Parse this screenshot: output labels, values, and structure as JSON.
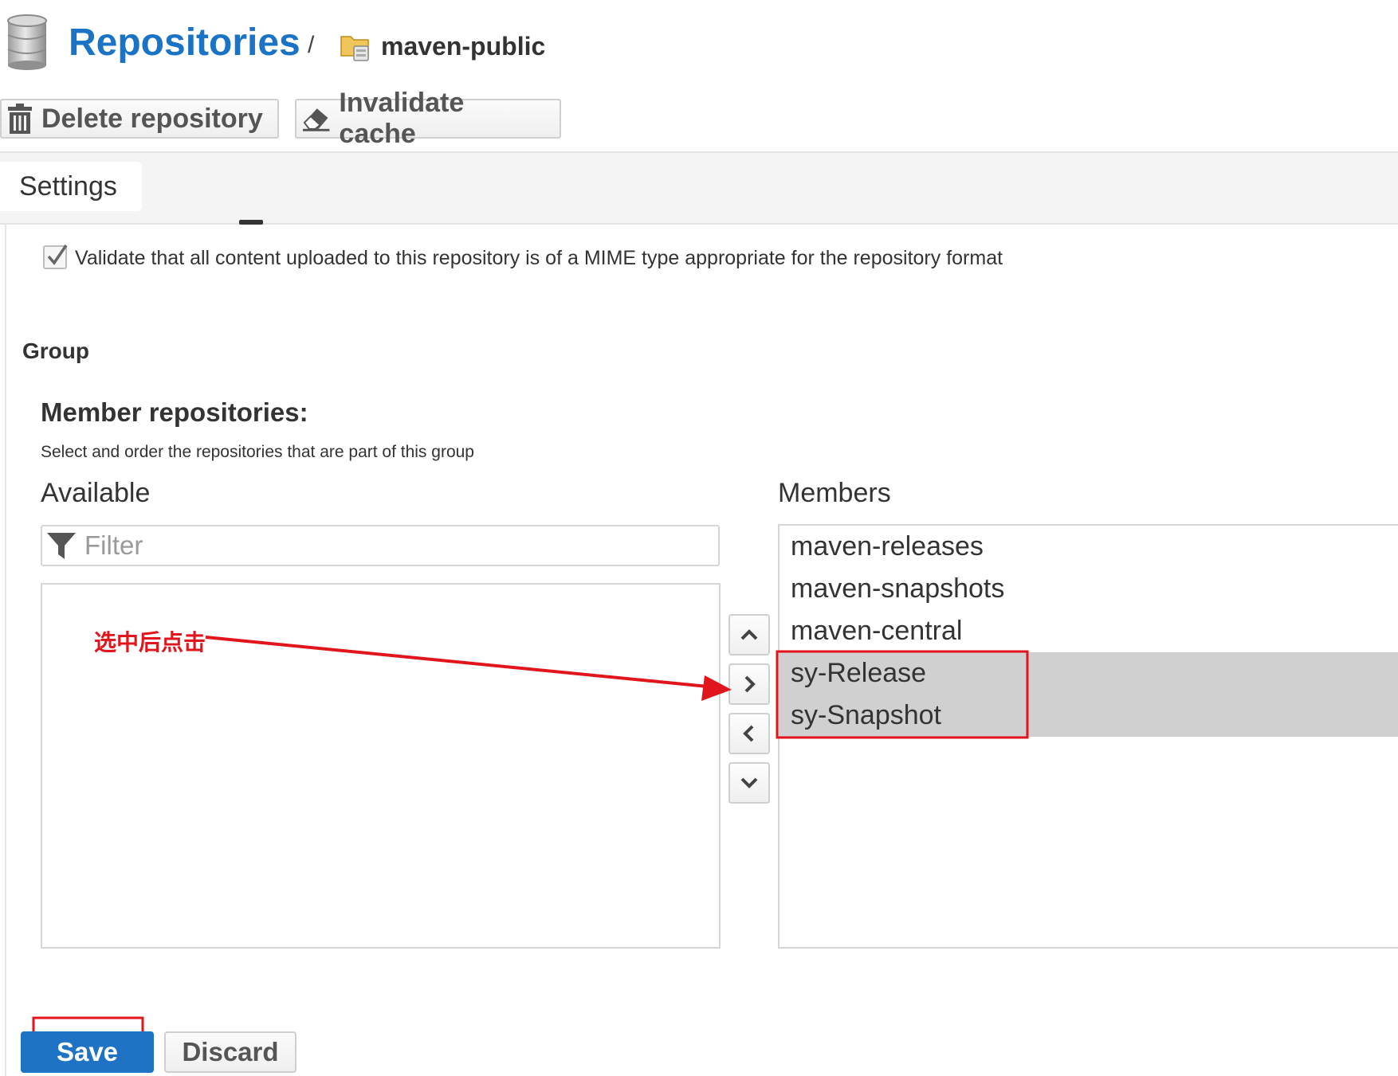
{
  "header": {
    "title": "Repositories",
    "separator": "/",
    "current_repository": "maven-public",
    "title_icon": "database-icon",
    "repository_icon": "folder-icon"
  },
  "toolbar": {
    "delete_label": "Delete repository",
    "delete_icon": "trash-icon",
    "invalidate_label": "Invalidate cache",
    "invalidate_icon": "eraser-icon"
  },
  "tabs": [
    {
      "label": "Settings",
      "active": true
    }
  ],
  "storage": {
    "validate_checked": true,
    "validate_label": "Validate that all content uploaded to this repository is of a MIME type appropriate for the repository format"
  },
  "group": {
    "heading": "Group",
    "member_heading": "Member repositories:",
    "member_description": "Select and order the repositories that are part of this group",
    "available_label": "Available",
    "members_label": "Members",
    "filter_placeholder": "Filter",
    "filter_icon": "filter-icon",
    "available_items": [],
    "members": [
      {
        "name": "maven-releases",
        "selected": false
      },
      {
        "name": "maven-snapshots",
        "selected": false
      },
      {
        "name": "maven-central",
        "selected": false
      },
      {
        "name": "sy-Release",
        "selected": true
      },
      {
        "name": "sy-Snapshot",
        "selected": true
      }
    ],
    "move_buttons": [
      "chevron-up-icon",
      "chevron-right-icon",
      "chevron-left-icon",
      "chevron-down-icon"
    ]
  },
  "annotation": {
    "text": "选中后点击",
    "color": "#e0161c"
  },
  "actions": {
    "save_label": "Save",
    "discard_label": "Discard"
  },
  "colors": {
    "accent": "#1a73c4",
    "save_button": "#1f73c5",
    "selected_row": "#d0d0d0",
    "annotation": "#e0161c"
  }
}
